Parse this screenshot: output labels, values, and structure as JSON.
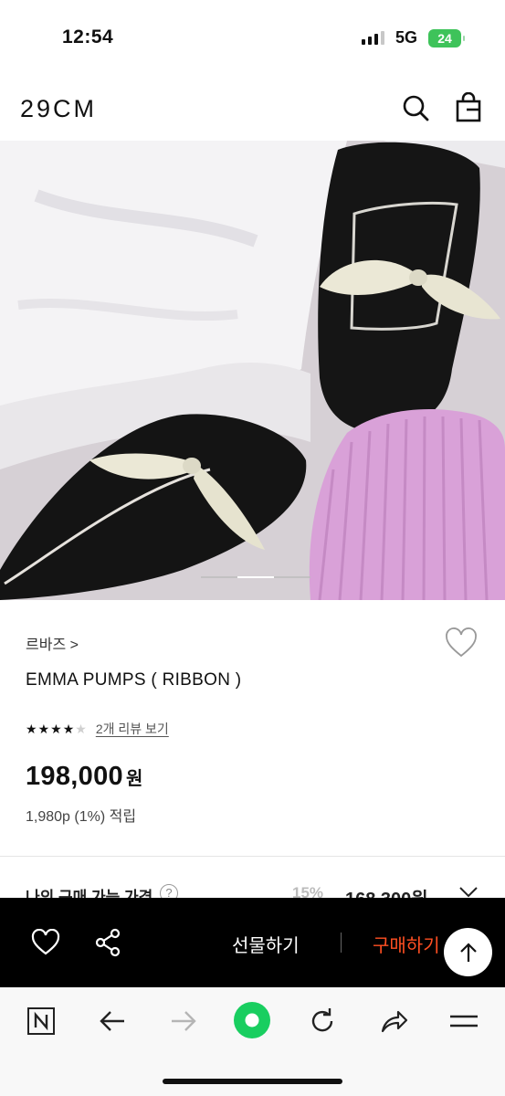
{
  "status_bar": {
    "time": "12:54",
    "network": "5G",
    "battery": "24"
  },
  "header": {
    "logo": "29CM",
    "icons": [
      "search-icon",
      "shopping-bag-icon"
    ]
  },
  "gallery": {
    "current_slide": 2,
    "total_slides": 3
  },
  "product": {
    "brand": "르바즈 >",
    "name": "EMMA PUMPS ( RIBBON )",
    "rating": 4,
    "rating_max": 5,
    "review_link": "2개 리뷰 보기",
    "price": "198,000",
    "currency": "원",
    "points": "1,980p (1%) 적립"
  },
  "my_price": {
    "label": "나의 구매 가능 가격",
    "help": "?",
    "discount": "15%",
    "price": "168,300원"
  },
  "action_bar": {
    "gift_label": "선물하기",
    "buy_label": "구매하기",
    "buy_color": "#ff4f22"
  },
  "browser_bar": {
    "icons": [
      "naver-n-icon",
      "back-arrow-icon",
      "forward-arrow-icon",
      "green-home-icon",
      "refresh-icon",
      "share-icon",
      "menu-icon"
    ],
    "accent": "#19ce60"
  }
}
